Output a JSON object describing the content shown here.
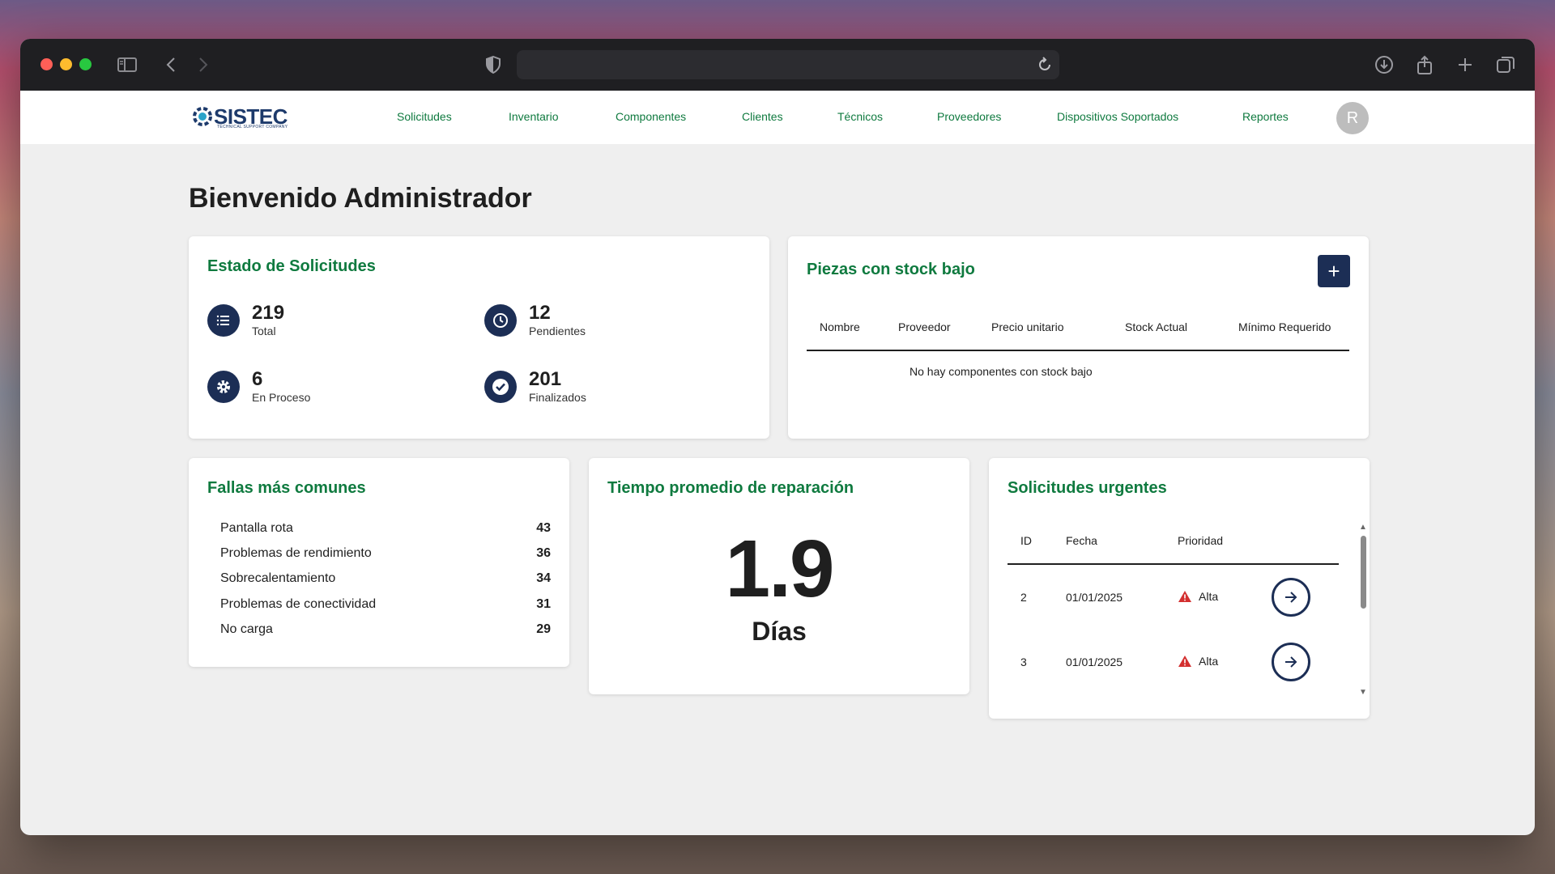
{
  "browser": {
    "traffic_colors": [
      "#ff5f57",
      "#febc2e",
      "#28c840"
    ]
  },
  "nav": {
    "logo": "SISTEC",
    "logo_tagline": "TECHNICAL SUPPORT COMPANY",
    "links": [
      "Solicitudes",
      "Inventario",
      "Componentes",
      "Clientes",
      "Técnicos",
      "Proveedores",
      "Dispositivos Soportados",
      "Reportes"
    ],
    "avatar_initial": "R"
  },
  "page": {
    "title": "Bienvenido Administrador"
  },
  "estado": {
    "title": "Estado de Solicitudes",
    "stats": [
      {
        "value": "219",
        "label": "Total",
        "icon": "list-icon"
      },
      {
        "value": "12",
        "label": "Pendientes",
        "icon": "clock-icon"
      },
      {
        "value": "6",
        "label": "En Proceso",
        "icon": "gear-icon"
      },
      {
        "value": "201",
        "label": "Finalizados",
        "icon": "check-icon"
      }
    ]
  },
  "stock": {
    "title": "Piezas con stock bajo",
    "add_icon": "+",
    "columns": [
      "Nombre",
      "Proveedor",
      "Precio unitario",
      "Stock Actual",
      "Mínimo Requerido"
    ],
    "empty_message": "No hay componentes con stock bajo"
  },
  "fallas": {
    "title": "Fallas más comunes",
    "items": [
      {
        "name": "Pantalla rota",
        "count": "43"
      },
      {
        "name": "Problemas de rendimiento",
        "count": "36"
      },
      {
        "name": "Sobrecalentamiento",
        "count": "34"
      },
      {
        "name": "Problemas de conectividad",
        "count": "31"
      },
      {
        "name": "No carga",
        "count": "29"
      }
    ]
  },
  "tiempo": {
    "title": "Tiempo promedio de reparación",
    "value": "1.9",
    "unit": "Días"
  },
  "urgentes": {
    "title": "Solicitudes urgentes",
    "columns": [
      "ID",
      "Fecha",
      "Prioridad"
    ],
    "rows": [
      {
        "id": "2",
        "fecha": "01/01/2025",
        "prioridad": "Alta"
      },
      {
        "id": "3",
        "fecha": "01/01/2025",
        "prioridad": "Alta"
      }
    ]
  }
}
